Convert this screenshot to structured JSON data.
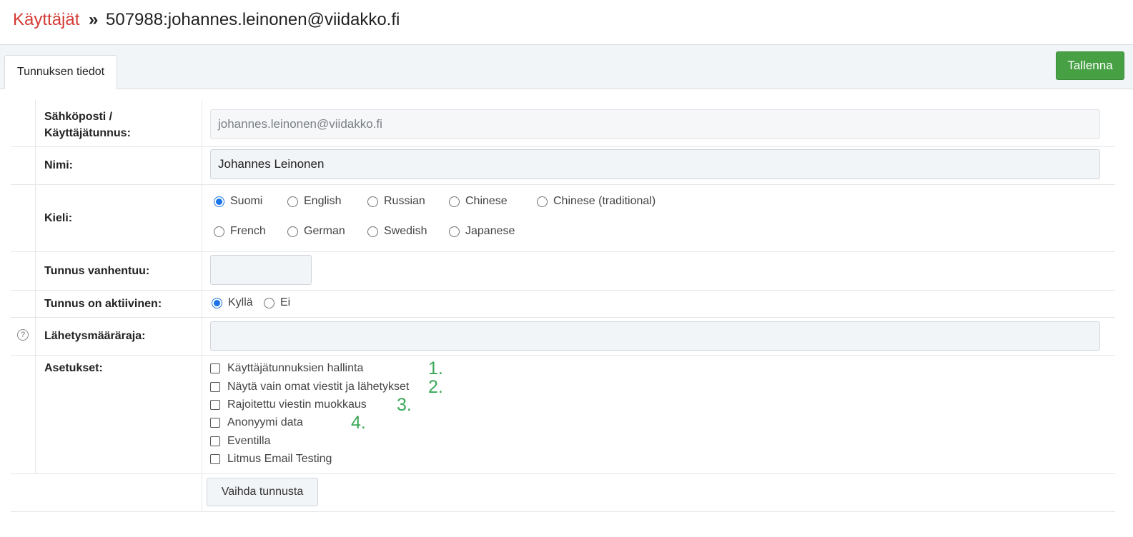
{
  "breadcrumb": {
    "parent": "Käyttäjät",
    "separator": "»",
    "current": "507988:johannes.leinonen@viidakko.fi"
  },
  "tabs": [
    {
      "label": "Tunnuksen tiedot"
    }
  ],
  "toolbar": {
    "save_label": "Tallenna"
  },
  "form": {
    "email": {
      "label_line1": "Sähköposti /",
      "label_line2": "Käyttäjätunnus:",
      "value": "johannes.leinonen@viidakko.fi"
    },
    "name": {
      "label": "Nimi:",
      "value": "Johannes Leinonen"
    },
    "language": {
      "label": "Kieli:",
      "options": [
        "Suomi",
        "English",
        "Russian",
        "Chinese",
        "Chinese (traditional)",
        "French",
        "German",
        "Swedish",
        "Japanese"
      ],
      "selected": "Suomi"
    },
    "expires": {
      "label": "Tunnus vanhentuu:",
      "value": ""
    },
    "active": {
      "label": "Tunnus on aktiivinen:",
      "options": [
        "Kyllä",
        "Ei"
      ],
      "selected": "Kyllä"
    },
    "send_limit": {
      "label": "Lähetysmääräraja:",
      "value": ""
    },
    "settings": {
      "label": "Asetukset:",
      "items": [
        {
          "label": "Käyttäjätunnuksien hallinta",
          "checked": false,
          "marker": "1."
        },
        {
          "label": "Näytä vain omat viestit ja lähetykset",
          "checked": false,
          "marker": "2."
        },
        {
          "label": "Rajoitettu viestin muokkaus",
          "checked": false,
          "marker": "3."
        },
        {
          "label": "Anonyymi data",
          "checked": false,
          "marker": "4."
        },
        {
          "label": "Eventilla",
          "checked": false
        },
        {
          "label": "Litmus Email Testing",
          "checked": false
        }
      ]
    },
    "change_account_label": "Vaihda tunnusta"
  },
  "colors": {
    "accent": "#48a045",
    "link": "#d43a34",
    "marker": "#3aa757",
    "radio": "#1a73e8"
  }
}
